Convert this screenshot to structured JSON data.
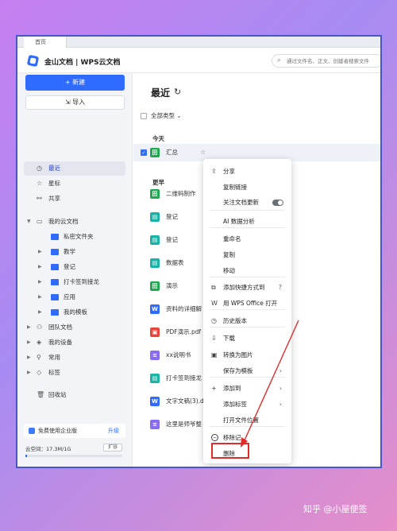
{
  "browser": {
    "tab_label": "首页"
  },
  "header": {
    "app_title": "金山文档 | WPS云文档",
    "search_placeholder": "通过文件名、正文、创建者搜索文件"
  },
  "sidebar": {
    "new_label": "+ 新建",
    "import_label": "导入",
    "nav": [
      {
        "label": "最近",
        "icon": "clock-icon"
      },
      {
        "label": "星标",
        "icon": "star-icon"
      },
      {
        "label": "共享",
        "icon": "share-icon"
      },
      {
        "label": "我的云文档",
        "icon": "cloud-folder-icon"
      },
      {
        "label": "私密文件夹",
        "icon": "lock-folder-icon"
      },
      {
        "label": "教学",
        "icon": "folder-icon"
      },
      {
        "label": "登记",
        "icon": "folder-icon"
      },
      {
        "label": "打卡签到接龙",
        "icon": "folder-icon"
      },
      {
        "label": "应用",
        "icon": "folder-icon"
      },
      {
        "label": "我的模板",
        "icon": "folder-icon"
      },
      {
        "label": "团队文档",
        "icon": "team-icon"
      },
      {
        "label": "我的设备",
        "icon": "device-icon"
      },
      {
        "label": "常用",
        "icon": "pin-icon"
      },
      {
        "label": "标签",
        "icon": "tag-icon"
      },
      {
        "label": "回收站",
        "icon": "trash-icon"
      }
    ],
    "promo_label": "免费使用企业版",
    "promo_upgrade": "升级",
    "storage_label": "云空间：17.3M/1G",
    "expand_label": "扩容",
    "storage_fraction": 0.017
  },
  "main": {
    "title": "最近",
    "filter_label": "全部类型",
    "today_label": "今天",
    "earlier_label": "更早",
    "today_files": [
      {
        "name": "汇总",
        "type": "sheet"
      }
    ],
    "earlier_files": [
      {
        "name": "二维码制作",
        "type": "sheet"
      },
      {
        "name": "登记",
        "type": "form"
      },
      {
        "name": "登记",
        "type": "form"
      },
      {
        "name": "数据表",
        "type": "form"
      },
      {
        "name": "演示",
        "type": "sheet"
      },
      {
        "name": "资料的详细解",
        "type": "word"
      },
      {
        "name": "PDF演示.pdf",
        "type": "pdf"
      },
      {
        "name": "xx说明书",
        "type": "doc"
      },
      {
        "name": "打卡签到接龙",
        "type": "form"
      },
      {
        "name": "文字文稿(3).d",
        "type": "word"
      },
      {
        "name": "这里是师爷整",
        "type": "doc"
      }
    ]
  },
  "context_menu": {
    "items": [
      {
        "label": "分享",
        "icon": "share-icon"
      },
      {
        "label": "复制链接",
        "icon": ""
      },
      {
        "label": "关注文档更新",
        "icon": ""
      },
      {
        "label": "AI 数据分析",
        "icon": ""
      },
      {
        "label": "重命名",
        "icon": ""
      },
      {
        "label": "复制",
        "icon": ""
      },
      {
        "label": "移动",
        "icon": ""
      },
      {
        "label": "添加快捷方式到",
        "icon": "shortcut-icon"
      },
      {
        "label": "用 WPS Office 打开",
        "icon": "wps-icon"
      },
      {
        "label": "历史版本",
        "icon": "history-icon"
      },
      {
        "label": "下载",
        "icon": "download-icon"
      },
      {
        "label": "转换为图片",
        "icon": "image-icon"
      },
      {
        "label": "保存为模板",
        "icon": ""
      },
      {
        "label": "添加到",
        "icon": "plus-icon"
      },
      {
        "label": "添加标签",
        "icon": ""
      },
      {
        "label": "打开文件位置",
        "icon": ""
      },
      {
        "label": "移除记",
        "icon": "remove-icon"
      },
      {
        "label": "删除",
        "icon": ""
      }
    ]
  },
  "watermark": "知乎 @小屋便签",
  "colors": {
    "accent": "#2f6bff",
    "highlight": "#e02b2b"
  }
}
